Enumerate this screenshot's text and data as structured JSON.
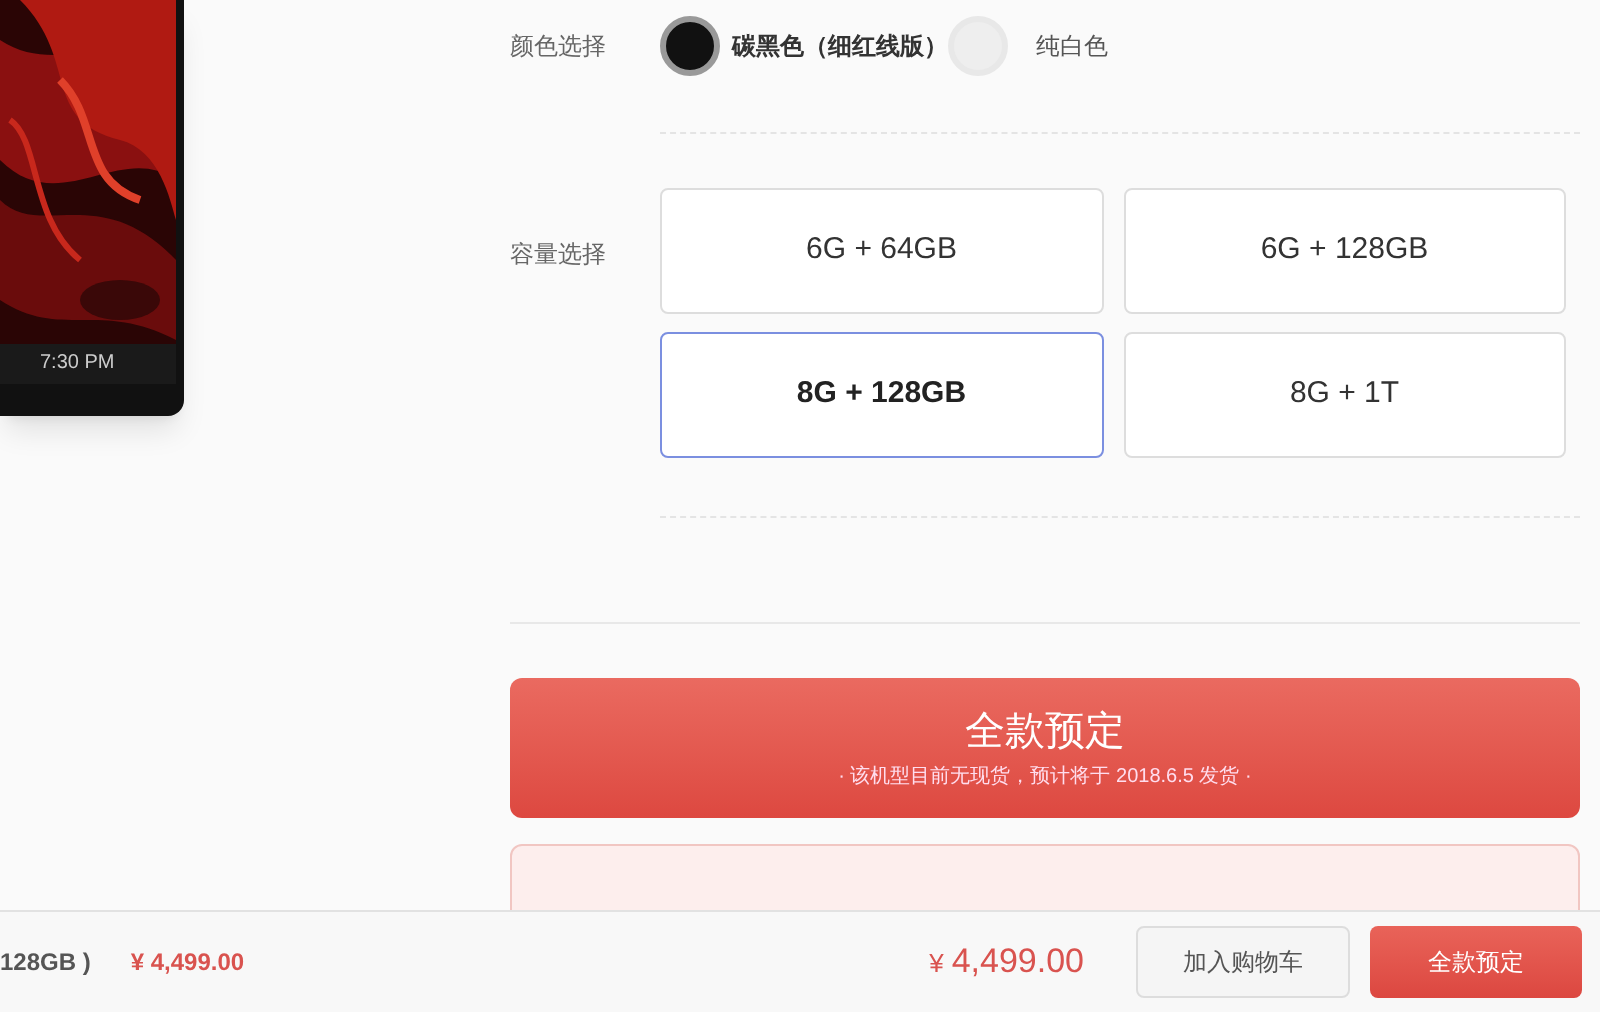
{
  "color_select": {
    "label": "颜色选择",
    "options": [
      {
        "name": "碳黑色（细红线版）",
        "color": "#111111",
        "selected": true
      },
      {
        "name": "纯白色",
        "color": "#eeeeee",
        "selected": false
      }
    ]
  },
  "capacity_select": {
    "label": "容量选择",
    "options": [
      {
        "name": "6G + 64GB",
        "selected": false
      },
      {
        "name": "6G + 128GB",
        "selected": false
      },
      {
        "name": "8G + 128GB",
        "selected": true
      },
      {
        "name": "8G + 1T",
        "selected": false
      }
    ]
  },
  "preorder_button": {
    "title": "全款预定",
    "note": "· 该机型目前无现货，预计将于 2018.6.5 发货 ·"
  },
  "phone_time": "7:30 PM",
  "bottom_bar": {
    "summary": "128GB )",
    "summary_price": "¥ 4,499.00",
    "price_symbol": "¥",
    "price": "4,499.00",
    "cart_button": "加入购物车",
    "buy_button": "全款预定"
  }
}
